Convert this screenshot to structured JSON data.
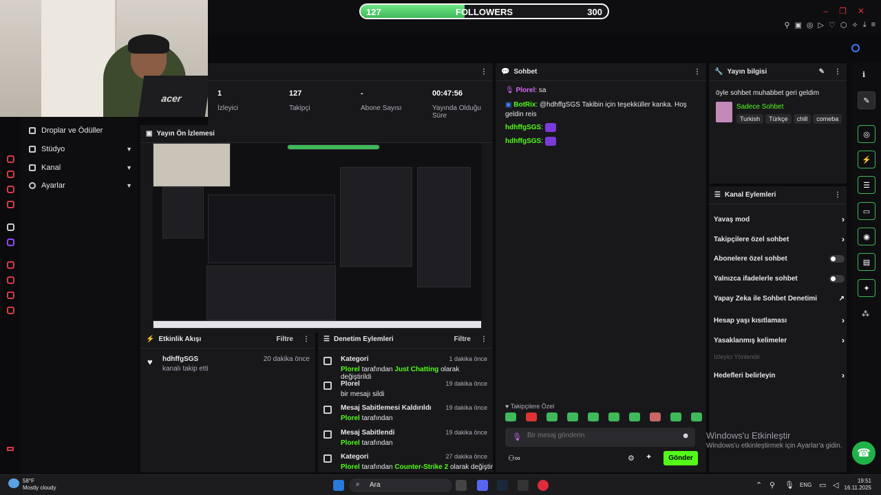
{
  "goal": {
    "current": "127",
    "label": "FOLLOWERS",
    "target": "300",
    "progress": 0.42
  },
  "stats": [
    {
      "value": "1",
      "label": "İzleyici"
    },
    {
      "value": "127",
      "label": "Takipçi"
    },
    {
      "value": "-",
      "label": "Abone Sayısı"
    },
    {
      "value": "00:47:56",
      "label": "Yayında Olduğu Süre"
    }
  ],
  "nav": {
    "items": [
      {
        "label": "Droplar ve Ödüller",
        "icon": "gift-icon"
      },
      {
        "label": "Stüdyo",
        "icon": "studio-icon"
      },
      {
        "label": "Kanal",
        "icon": "channel-icon"
      },
      {
        "label": "Ayarlar",
        "icon": "settings-icon"
      }
    ]
  },
  "preview": {
    "title": "Yayın Ön İzlemesi"
  },
  "activity": {
    "title": "Etkinlik Akışı",
    "filter": "Filtre",
    "items": [
      {
        "user": "hdhffgSGS",
        "text": "kanalı takip etti",
        "time": "20 dakika önce"
      }
    ]
  },
  "modlog": {
    "title": "Denetim Eylemleri",
    "filter": "Filtre",
    "items": [
      {
        "title": "Kategori",
        "time": "1 dakika önce",
        "actor": "Plorel",
        "mid": "tarafından",
        "value": "Just Chatting",
        "rest": "olarak değiştirildi"
      },
      {
        "title": "Plorel",
        "time": "19 dakika önce",
        "sub": "bir mesajı sildi"
      },
      {
        "title": "Mesaj Sabitlemesi Kaldırıldı",
        "time": "19 dakika önce",
        "actor": "Plorel",
        "mid": "tarafından"
      },
      {
        "title": "Mesaj Sabitlendi",
        "time": "19 dakika önce",
        "actor": "Plorel",
        "mid": "tarafından"
      },
      {
        "title": "Kategori",
        "time": "27 dakika önce",
        "actor": "Plorel",
        "mid": "tarafından",
        "value": "Counter-Strike 2",
        "rest": "olarak değiştirildi"
      }
    ]
  },
  "chat": {
    "title": "Sohbet",
    "messages": [
      {
        "user": "Plorel",
        "text": "sa",
        "color": "#d56bf2"
      },
      {
        "user": "BotRix",
        "text": "@hdhffgSGS Takibin için teşekküller kanka. Hoş geldin reis",
        "color": "#53fc18"
      },
      {
        "user": "hdhffgSGS",
        "text": "",
        "color": "#53fc18"
      },
      {
        "user": "hdhffgSGS",
        "text": "",
        "color": "#53fc18"
      }
    ],
    "followers_only": "Takipçilere Özel",
    "placeholder": "Bir mesaj gönderin",
    "send": "Gönder"
  },
  "stream_info": {
    "title": "Yayın bilgisi",
    "stream_title": "öyle sohbet muhabbet geri geldim",
    "category": "Sadece Sohbet",
    "tags": [
      "Turkish",
      "Türkçe",
      "chill",
      "comeba"
    ]
  },
  "channel_actions": {
    "title": "Kanal Eylemleri",
    "items": [
      {
        "label": "Yavaş mod",
        "control": "arrow"
      },
      {
        "label": "Takipçilere özel sohbet",
        "control": "arrow"
      },
      {
        "label": "Abonelere özel sohbet",
        "control": "toggle"
      },
      {
        "label": "Yalnızca ifadelerle sohbet",
        "control": "toggle"
      },
      {
        "label": "Yapay Zeka ile Sohbet Denetimi",
        "control": "external"
      },
      {
        "label": "Hesap yaşı kısıtlaması",
        "control": "arrow"
      },
      {
        "label": "Yasaklanmış kelimeler",
        "control": "arrow"
      }
    ],
    "disabled_item": "İzleyici Yönlendir",
    "last_item": "Hedefleri belirleyin"
  },
  "watermark": {
    "title": "Windows'u Etkinleştir",
    "sub": "Windows'u etkinleştirmek için Ayarlar'a gidin."
  },
  "taskbar": {
    "weather_temp": "58°F",
    "weather_desc": "Mostly cloudy",
    "search": "Ara",
    "lang": "ENG",
    "time": "19:51",
    "date": "16.11.2025"
  }
}
